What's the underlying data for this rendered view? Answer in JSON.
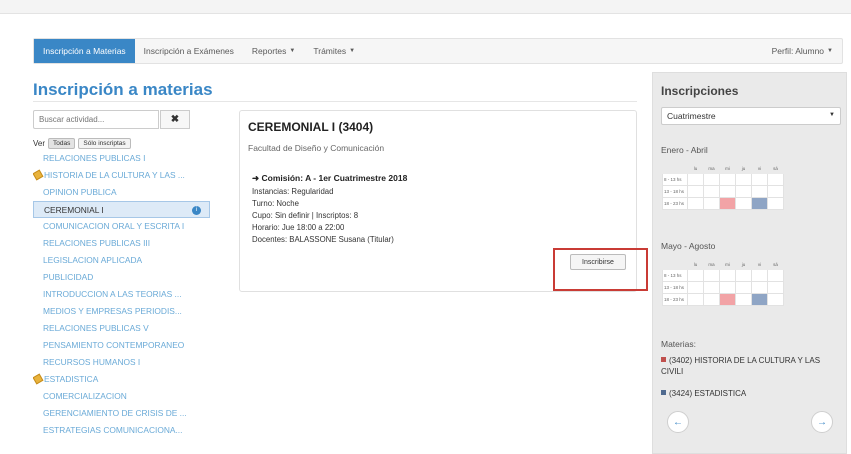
{
  "nav": {
    "items": [
      {
        "label": "Inscripción a Materias",
        "active": true
      },
      {
        "label": "Inscripción a Exámenes"
      },
      {
        "label": "Reportes",
        "dropdown": true
      },
      {
        "label": "Trámites",
        "dropdown": true
      }
    ],
    "profile": "Perfil: Alumno"
  },
  "page_title": "Inscripción a materias",
  "search": {
    "placeholder": "Buscar actividad..."
  },
  "filter": {
    "label": "Ver",
    "options": [
      "Todas",
      "Sólo inscriptas"
    ]
  },
  "subjects": [
    {
      "label": "RELACIONES PUBLICAS I"
    },
    {
      "label": "HISTORIA DE LA CULTURA Y LAS ...",
      "icon": "pencil-icon"
    },
    {
      "label": "OPINION PUBLICA"
    },
    {
      "label": "CEREMONIAL I",
      "selected": true
    },
    {
      "label": "COMUNICACION ORAL Y ESCRITA I"
    },
    {
      "label": "RELACIONES PUBLICAS III"
    },
    {
      "label": "LEGISLACION APLICADA"
    },
    {
      "label": "PUBLICIDAD"
    },
    {
      "label": "INTRODUCCION A LAS TEORIAS ..."
    },
    {
      "label": "MEDIOS Y EMPRESAS PERIODIS..."
    },
    {
      "label": "RELACIONES PUBLICAS V"
    },
    {
      "label": "PENSAMIENTO CONTEMPORANEO"
    },
    {
      "label": "RECURSOS HUMANOS I"
    },
    {
      "label": "ESTADISTICA",
      "icon": "pencil-icon"
    },
    {
      "label": "COMERCIALIZACION"
    },
    {
      "label": "GERENCIAMIENTO DE CRISIS DE ..."
    },
    {
      "label": "ESTRATEGIAS COMUNICACIONA..."
    }
  ],
  "card": {
    "title": "CEREMONIAL I (3404)",
    "faculty": "Facultad de Diseño y Comunicación",
    "comision": "Comisión: A - 1er Cuatrimestre 2018",
    "instancias": "Instancias: Regularidad",
    "turno": "Turno: Noche",
    "cupo": "Cupo: Sin definir | Inscriptos: 8",
    "horario": "Horario: Jue 18:00 a 22:00",
    "docentes": "Docentes: BALASSONE Susana (Titular)",
    "button": "Inscribirse"
  },
  "right": {
    "title": "Inscripciones",
    "period_select": "Cuatrimestre",
    "period1": "Enero - Abril",
    "period2": "Mayo - Agosto",
    "days": [
      "lu",
      "ma",
      "mi",
      "ju",
      "vi",
      "sá"
    ],
    "rows": [
      "8 - 13 hs",
      "13 - 18 hs",
      "18 - 23 hs"
    ],
    "materias_label": "Materias:",
    "materias": [
      {
        "label": "(3402) HISTORIA DE LA CULTURA Y LAS CIVILI",
        "color": "#c0504d"
      },
      {
        "label": "(3424) ESTADISTICA",
        "color": "#4f6a8f"
      }
    ],
    "prev_icon": "arrow-left-icon",
    "next_icon": "arrow-right-icon"
  },
  "colors": {
    "accent": "#3a87c6",
    "highlight": "#c93b35",
    "slot_pink": "#f2a3a6",
    "slot_blue": "#8fa5c5"
  }
}
